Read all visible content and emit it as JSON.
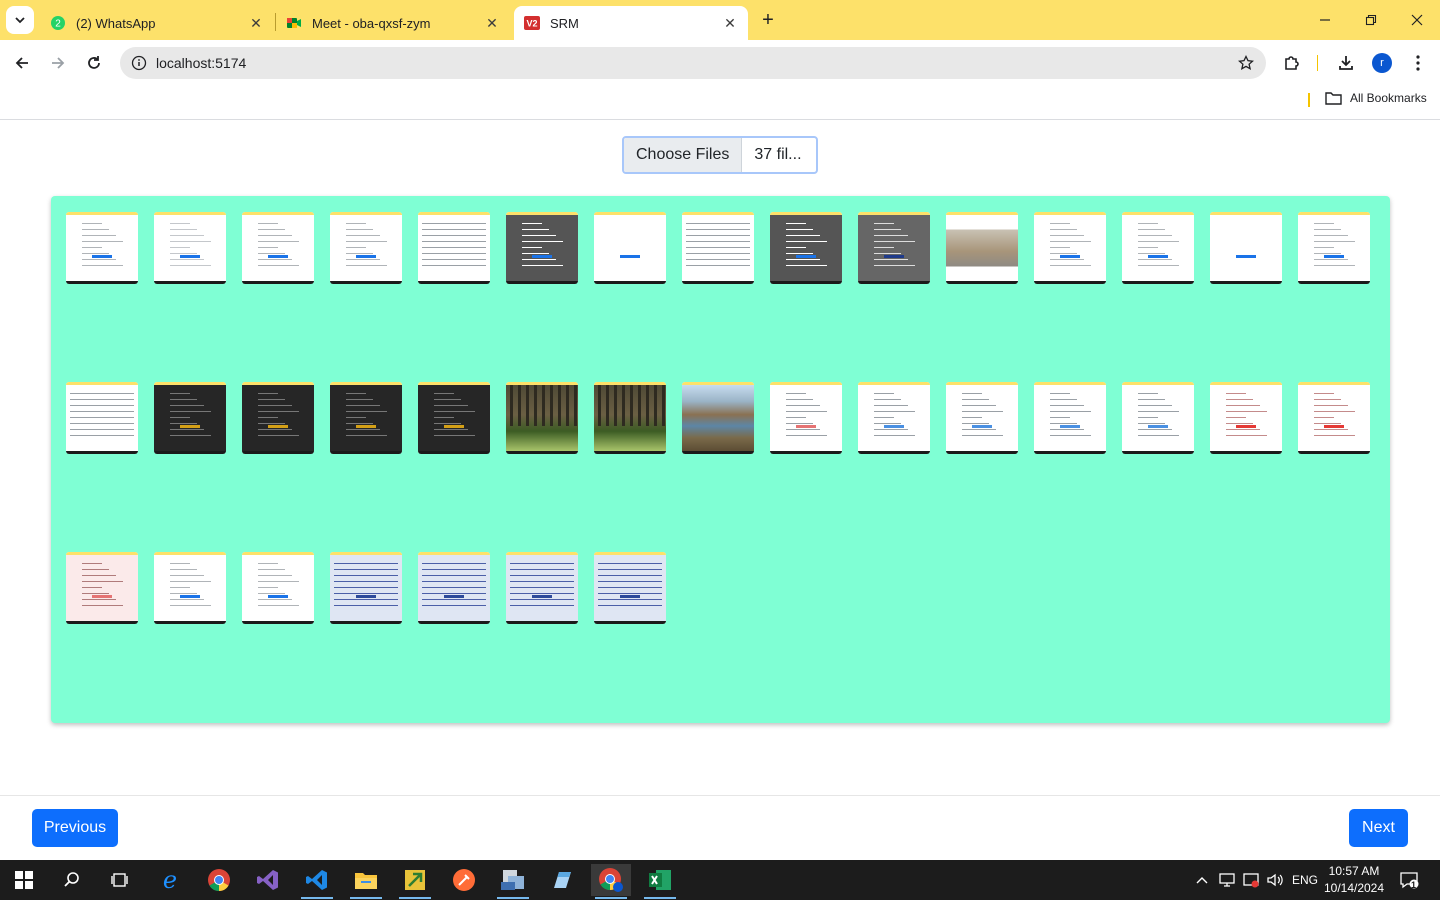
{
  "browser": {
    "tabs": [
      {
        "title": "(2) WhatsApp",
        "favicon": "whatsapp-icon",
        "active": false
      },
      {
        "title": "Meet - oba-qxsf-zym",
        "favicon": "meet-icon",
        "active": false
      },
      {
        "title": "SRM",
        "favicon": "srm-icon",
        "active": true
      }
    ],
    "url": "localhost:5174",
    "bookmarks_label": "All Bookmarks",
    "profile_initial": "r"
  },
  "page": {
    "file_input": {
      "button_label": "Choose Files",
      "selection_text": "37 fil..."
    },
    "panel_color": "#7fffd4",
    "thumbnails": [
      {
        "kind": "form"
      },
      {
        "kind": "dialog"
      },
      {
        "kind": "form"
      },
      {
        "kind": "form"
      },
      {
        "kind": "table"
      },
      {
        "kind": "dark-modal"
      },
      {
        "kind": "blank-button"
      },
      {
        "kind": "table"
      },
      {
        "kind": "dark-modal"
      },
      {
        "kind": "dark-table"
      },
      {
        "kind": "photo-building"
      },
      {
        "kind": "form"
      },
      {
        "kind": "form"
      },
      {
        "kind": "blank-button"
      },
      {
        "kind": "form"
      },
      {
        "kind": "table"
      },
      {
        "kind": "dark-code"
      },
      {
        "kind": "dark-code"
      },
      {
        "kind": "dark-code"
      },
      {
        "kind": "dark-code"
      },
      {
        "kind": "photo-forest"
      },
      {
        "kind": "photo-forest"
      },
      {
        "kind": "photo-river"
      },
      {
        "kind": "table-red"
      },
      {
        "kind": "code-light"
      },
      {
        "kind": "code-light"
      },
      {
        "kind": "code-light"
      },
      {
        "kind": "code-light"
      },
      {
        "kind": "pink-form"
      },
      {
        "kind": "pink-form"
      },
      {
        "kind": "pink-table"
      },
      {
        "kind": "form"
      },
      {
        "kind": "form"
      },
      {
        "kind": "ide"
      },
      {
        "kind": "ide"
      },
      {
        "kind": "ide"
      },
      {
        "kind": "ide"
      }
    ],
    "previous_label": "Previous",
    "next_label": "Next",
    "button_color": "#0d6efd"
  },
  "taskbar": {
    "apps": [
      "start-icon",
      "search-icon",
      "task-view-icon",
      "edge-icon",
      "chrome-icon",
      "visual-studio-icon",
      "vscode-icon",
      "file-explorer-icon",
      "sticky-app-icon",
      "postman-icon",
      "ssms-icon",
      "notepad-icon",
      "chrome-profile-icon",
      "excel-icon"
    ],
    "language": "ENG",
    "time": "10:57 AM",
    "date": "10/14/2024",
    "notification_count": "1"
  }
}
